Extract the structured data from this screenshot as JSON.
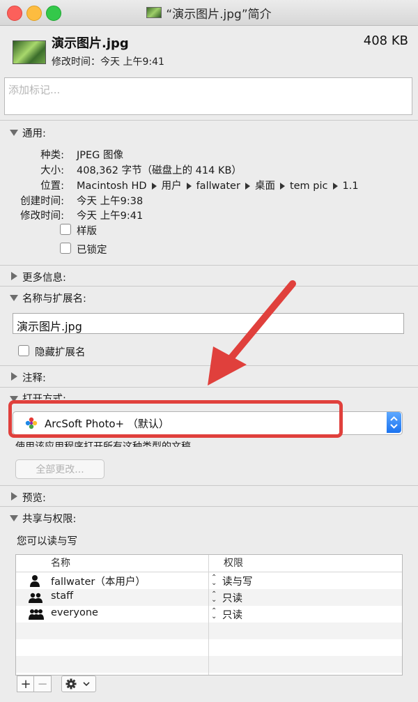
{
  "window": {
    "title": "“演示图片.jpg”简介"
  },
  "header": {
    "file_name": "演示图片.jpg",
    "file_size": "408 KB",
    "modified_line": "修改时间：今天 上午9:41"
  },
  "tags": {
    "placeholder": "添加标记..."
  },
  "general": {
    "title": "通用:",
    "rows": [
      {
        "label": "种类:",
        "value": "JPEG 图像"
      },
      {
        "label": "大小:",
        "value": "408,362 字节（磁盘上的 414 KB）"
      },
      {
        "label": "创建时间:",
        "value": "今天 上午9:38"
      },
      {
        "label": "修改时间:",
        "value": "今天 上午9:41"
      }
    ],
    "location_label": "位置:",
    "location_path": [
      "Macintosh HD",
      "用户",
      "fallwater",
      "桌面",
      "tem pic",
      "1.1"
    ],
    "checkbox_stationery": "样版",
    "checkbox_locked": "已锁定"
  },
  "more_info": {
    "title": "更多信息:"
  },
  "name_ext": {
    "title": "名称与扩展名:",
    "value": "演示图片.jpg",
    "hide_ext": "隐藏扩展名"
  },
  "comments": {
    "title": "注释:"
  },
  "open_with": {
    "title_partial": "打开方式:",
    "app": "ArcSoft Photo+ （默认）",
    "note_partial": "使用该应用程序打开所有这种类型的文稿。",
    "change_all": "全部更改..."
  },
  "preview": {
    "title": "预览:"
  },
  "sharing": {
    "title": "共享与权限:",
    "note": "您可以读与写",
    "col_name": "名称",
    "col_priv": "权限",
    "rows": [
      {
        "name": "fallwater（本用户）",
        "priv": "读与写",
        "icon": "user-icon"
      },
      {
        "name": "staff",
        "priv": "只读",
        "icon": "group-icon"
      },
      {
        "name": "everyone",
        "priv": "只读",
        "icon": "everyone-icon"
      }
    ],
    "add": "+",
    "remove": "−"
  },
  "colors": {
    "annotation_red": "#e0403c",
    "accent_blue": "#1a73f0"
  }
}
